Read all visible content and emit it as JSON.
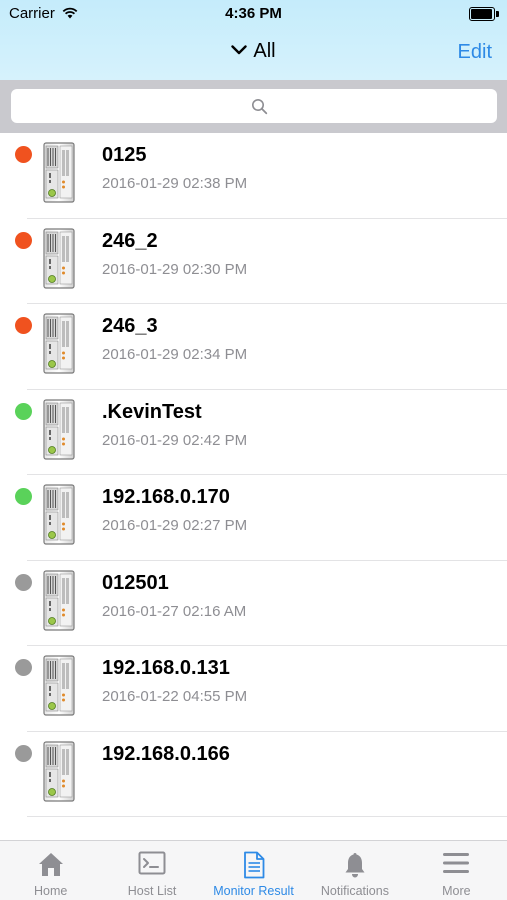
{
  "status_bar": {
    "carrier": "Carrier",
    "time": "4:36 PM"
  },
  "nav": {
    "title": "All",
    "edit_label": "Edit"
  },
  "search": {
    "placeholder": ""
  },
  "colors": {
    "offline": "#f0521f",
    "online": "#5ad25a",
    "unknown": "#9a9a9a",
    "accent": "#2e8ae6"
  },
  "hosts": [
    {
      "name": "0125",
      "time": "2016-01-29 02:38 PM",
      "status": "offline"
    },
    {
      "name": "246_2",
      "time": "2016-01-29 02:30 PM",
      "status": "offline"
    },
    {
      "name": "246_3",
      "time": "2016-01-29 02:34 PM",
      "status": "offline"
    },
    {
      "name": ".KevinTest",
      "time": "2016-01-29 02:42 PM",
      "status": "online"
    },
    {
      "name": "192.168.0.170",
      "time": "2016-01-29 02:27 PM",
      "status": "online"
    },
    {
      "name": "012501",
      "time": "2016-01-27 02:16 AM",
      "status": "unknown"
    },
    {
      "name": "192.168.0.131",
      "time": "2016-01-22 04:55 PM",
      "status": "unknown"
    },
    {
      "name": "192.168.0.166",
      "time": "",
      "status": "unknown"
    }
  ],
  "tabs": [
    {
      "label": "Home",
      "icon": "home-icon"
    },
    {
      "label": "Host List",
      "icon": "terminal-icon"
    },
    {
      "label": "Monitor Result",
      "icon": "document-icon",
      "active": true
    },
    {
      "label": "Notifications",
      "icon": "bell-icon"
    },
    {
      "label": "More",
      "icon": "menu-icon"
    }
  ]
}
